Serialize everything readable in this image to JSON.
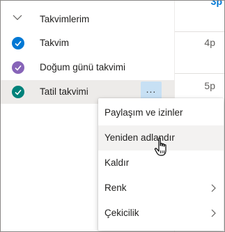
{
  "sidebar": {
    "group": {
      "title": "Takvimlerim",
      "chevron_icon": "chevron-down-icon"
    },
    "calendars": [
      {
        "label": "Takvim",
        "color": "#0078d4",
        "checked": true
      },
      {
        "label": "Doğum günü takvimi",
        "color": "#8764b8",
        "checked": true
      },
      {
        "label": "Tatil takvimi",
        "color": "#00827a",
        "checked": true,
        "selected": true
      }
    ],
    "more_button": {
      "label": "...",
      "icon": "more-options-icon"
    }
  },
  "timeline": {
    "hours": [
      "3p",
      "4p",
      "5p"
    ],
    "current_hour": "3p",
    "accent_color": "#0078d4"
  },
  "context_menu": {
    "items": [
      {
        "label": "Paylaşım ve izinler",
        "has_submenu": false
      },
      {
        "label": "Yeniden adlandır",
        "has_submenu": false,
        "hovered": true
      },
      {
        "label": "Kaldır",
        "has_submenu": false
      },
      {
        "label": "Renk",
        "has_submenu": true
      },
      {
        "label": "Çekicilik",
        "has_submenu": true
      }
    ]
  },
  "cursor": {
    "icon": "hand-pointer-icon"
  }
}
